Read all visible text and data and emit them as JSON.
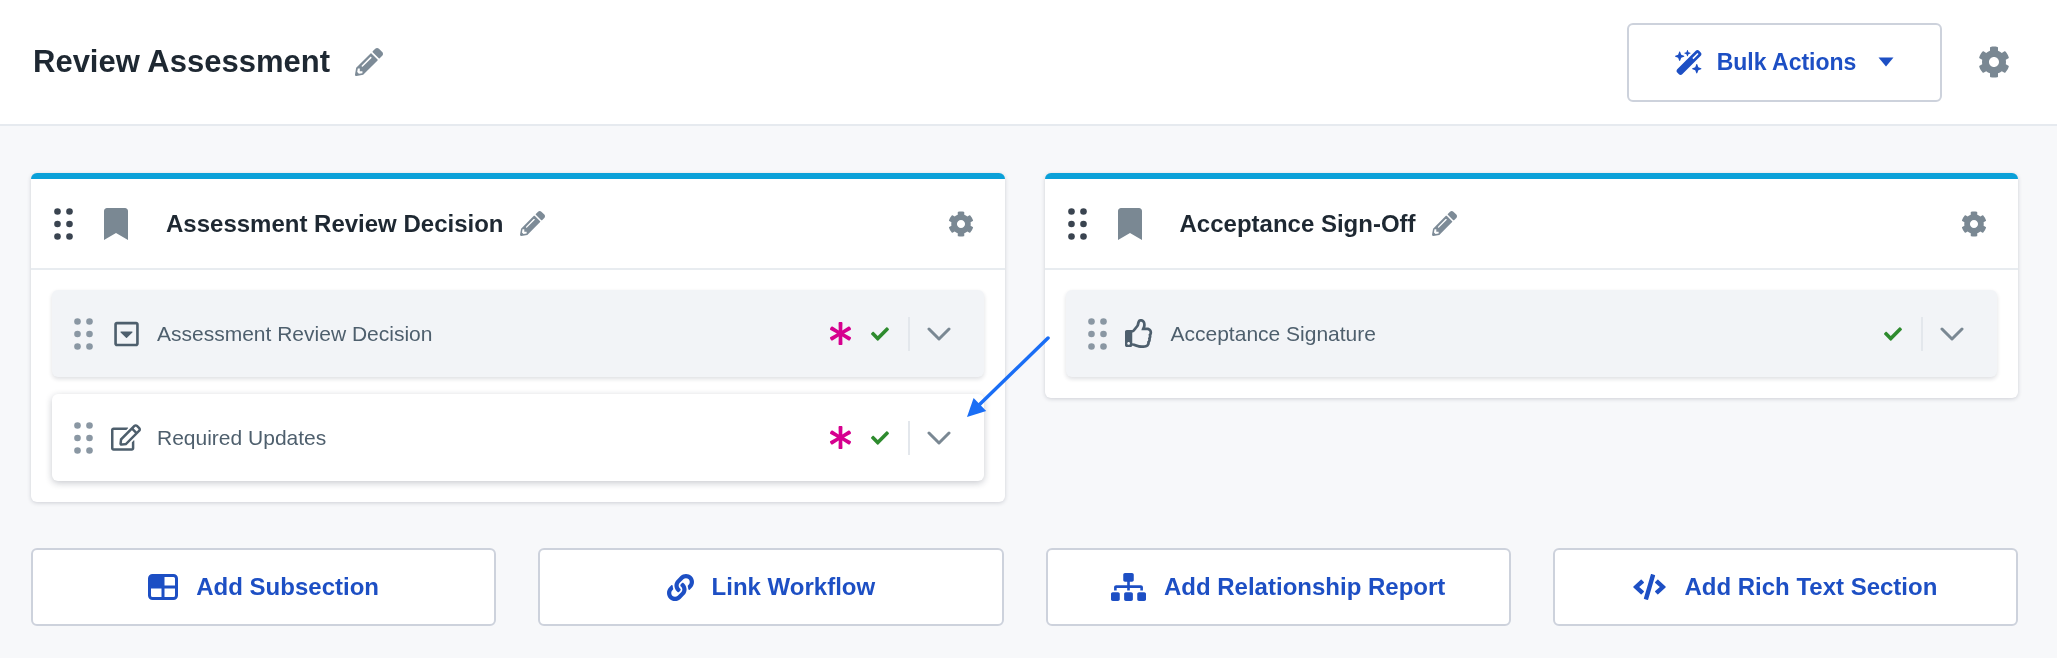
{
  "header": {
    "title": "Review Assessment",
    "bulk_actions": {
      "label": "Bulk Actions"
    }
  },
  "sections": [
    {
      "title": "Assessment Review Decision",
      "fields": [
        {
          "kind": "dropdown",
          "label": "Assessment Review Decision",
          "required": true,
          "valid": true,
          "hovered": false
        },
        {
          "kind": "text",
          "label": "Required Updates",
          "required": true,
          "valid": true,
          "hovered": true
        }
      ]
    },
    {
      "title": "Acceptance Sign-Off",
      "fields": [
        {
          "kind": "approval",
          "label": "Acceptance Signature",
          "required": false,
          "valid": true,
          "hovered": false
        }
      ]
    }
  ],
  "actions": [
    {
      "kind": "subsection",
      "label": "Add Subsection"
    },
    {
      "kind": "link",
      "label": "Link Workflow"
    },
    {
      "kind": "relationship",
      "label": "Add Relationship Report"
    },
    {
      "kind": "richtext",
      "label": "Add Rich Text Section"
    }
  ]
}
